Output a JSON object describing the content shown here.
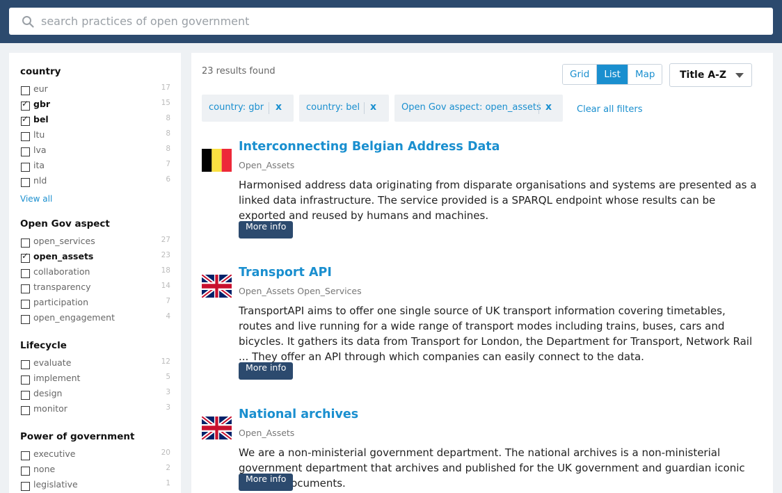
{
  "search": {
    "placeholder": "search practices of open government"
  },
  "facets": [
    {
      "title": "country",
      "items": [
        {
          "label": "eur",
          "count": "17",
          "checked": false
        },
        {
          "label": "gbr",
          "count": "15",
          "checked": true
        },
        {
          "label": "bel",
          "count": "8",
          "checked": true
        },
        {
          "label": "ltu",
          "count": "8",
          "checked": false
        },
        {
          "label": "lva",
          "count": "8",
          "checked": false
        },
        {
          "label": "ita",
          "count": "7",
          "checked": false
        },
        {
          "label": "nld",
          "count": "6",
          "checked": false
        }
      ],
      "view_all": "View all"
    },
    {
      "title": "Open Gov aspect",
      "items": [
        {
          "label": "open_services",
          "count": "27",
          "checked": false
        },
        {
          "label": "open_assets",
          "count": "23",
          "checked": true
        },
        {
          "label": "collaboration",
          "count": "18",
          "checked": false
        },
        {
          "label": "transparency",
          "count": "14",
          "checked": false
        },
        {
          "label": "participation",
          "count": "7",
          "checked": false
        },
        {
          "label": "open_engagement",
          "count": "4",
          "checked": false
        }
      ]
    },
    {
      "title": "Lifecycle",
      "items": [
        {
          "label": "evaluate",
          "count": "12",
          "checked": false
        },
        {
          "label": "implement",
          "count": "5",
          "checked": false
        },
        {
          "label": "design",
          "count": "3",
          "checked": false
        },
        {
          "label": "monitor",
          "count": "3",
          "checked": false
        }
      ]
    },
    {
      "title": "Power of government",
      "items": [
        {
          "label": "executive",
          "count": "20",
          "checked": false
        },
        {
          "label": "none",
          "count": "2",
          "checked": false
        },
        {
          "label": "legislative",
          "count": "1",
          "checked": false
        }
      ]
    }
  ],
  "main": {
    "results_count": "23 results found",
    "views": [
      "Grid",
      "List",
      "Map"
    ],
    "active_view": "List",
    "sort": "Title A-Z",
    "chips": [
      {
        "label": "country: gbr",
        "remove": "x"
      },
      {
        "label": "country: bel",
        "remove": "x"
      },
      {
        "label": "Open Gov aspect: open_assets",
        "remove": "x"
      }
    ],
    "clear_all": "Clear all filters",
    "more_label": "More info",
    "results": [
      {
        "flag": "belgium-flag-icon",
        "title": "Interconnecting Belgian Address Data",
        "tags": "Open_Assets",
        "description": "Harmonised address data originating from disparate organisations and systems are presented as a linked data infrastructure. The service provided is a SPARQL endpoint whose results can be exported and reused by humans and machines."
      },
      {
        "flag": "uk-flag-icon",
        "title": "Transport API",
        "tags": "Open_Assets Open_Services",
        "description": "TransportAPI aims to offer one single source of UK transport information covering timetables, routes and live running for a wide range of transport modes including trains, buses, cars and bicycles. It gathers its data from Transport for London, the Department for Transport, Network Rail ... They offer an API through which companies can easily connect to the data."
      },
      {
        "flag": "uk-flag-icon",
        "title": "National archives",
        "tags": "Open_Assets",
        "description": "We are a non-ministerial government department. The national archives is a non-ministerial government department that archives and published for the UK government and guardian iconic national documents."
      }
    ]
  },
  "colors": {
    "header": "#2c4a6e",
    "accent": "#1a8fcf",
    "button": "#2c4a6e"
  }
}
